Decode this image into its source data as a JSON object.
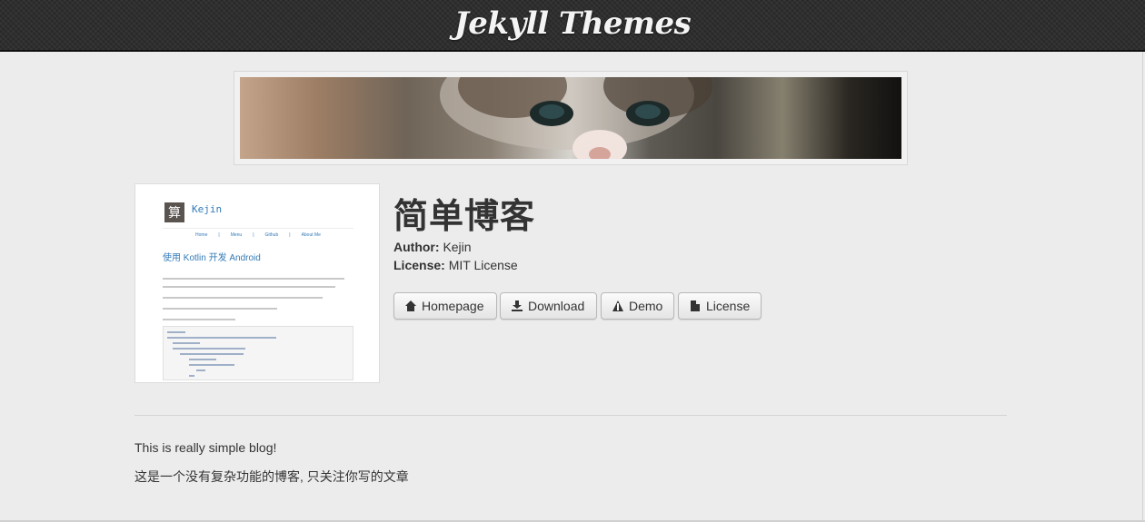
{
  "header": {
    "brand": "Jekyll Themes"
  },
  "theme": {
    "title": "简单博客",
    "author_label": "Author:",
    "author": "Kejin",
    "license_label": "License:",
    "license": "MIT License"
  },
  "buttons": {
    "homepage": "Homepage",
    "download": "Download",
    "demo": "Demo",
    "license": "License"
  },
  "thumbnail": {
    "logo_glyph": "算",
    "blog_name": "Kejin",
    "nav": [
      "Home",
      "|",
      "Menu",
      "|",
      "Github",
      "|",
      "About Me"
    ],
    "post_title": "使用 Kotlin 开发 Android"
  },
  "description": {
    "line1": "This is really simple blog!",
    "line2": "这是一个没有复杂功能的博客, 只关注你写的文章"
  },
  "colors": {
    "topbar": "#2e2e2e",
    "background": "#ececec",
    "link": "#337ab7"
  }
}
